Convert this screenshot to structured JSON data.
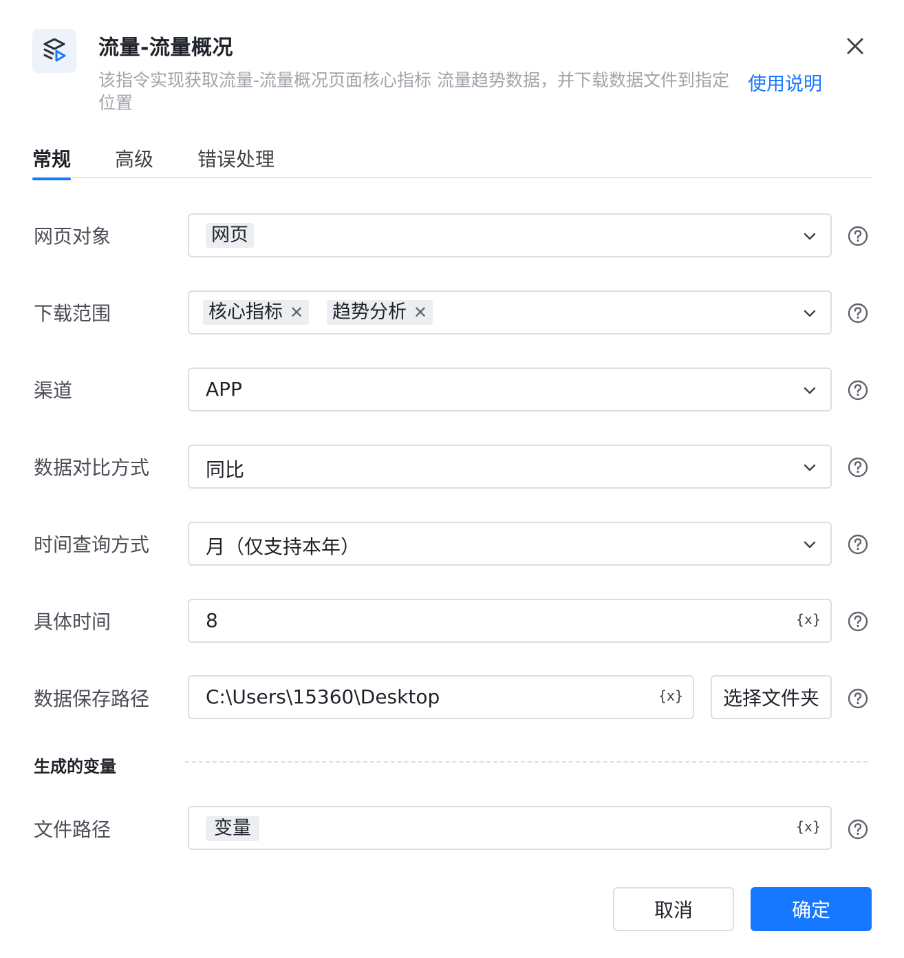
{
  "header": {
    "icon": "flow-stack-play-icon",
    "title": "流量-流量概况",
    "description": "该指令实现获取流量-流量概况页面核心指标 流量趋势数据，并下载数据文件到指定位置",
    "help_link": "使用说明",
    "close_icon": "close-icon"
  },
  "tabs": [
    {
      "label": "常规",
      "active": true
    },
    {
      "label": "高级",
      "active": false
    },
    {
      "label": "错误处理",
      "active": false
    }
  ],
  "form": {
    "web_object": {
      "label": "网页对象",
      "tag": "网页"
    },
    "download_scope": {
      "label": "下载范围",
      "tags": [
        "核心指标",
        "趋势分析"
      ]
    },
    "channel": {
      "label": "渠道",
      "value": "APP"
    },
    "compare_mode": {
      "label": "数据对比方式",
      "value": "同比"
    },
    "time_query_mode": {
      "label": "时间查询方式",
      "value": "月（仅支持本年）"
    },
    "specific_time": {
      "label": "具体时间",
      "value": "8"
    },
    "save_path": {
      "label": "数据保存路径",
      "value": "C:\\Users\\15360\\Desktop",
      "folder_button": "选择文件夹"
    }
  },
  "variables_section": {
    "title": "生成的变量",
    "file_path": {
      "label": "文件路径",
      "tag": "变量"
    }
  },
  "variable_icon_text": "{x}",
  "footer": {
    "cancel": "取消",
    "confirm": "确定"
  },
  "colors": {
    "accent": "#1677ff",
    "border": "#dcdee3",
    "muted_text": "#a0a4ab"
  }
}
